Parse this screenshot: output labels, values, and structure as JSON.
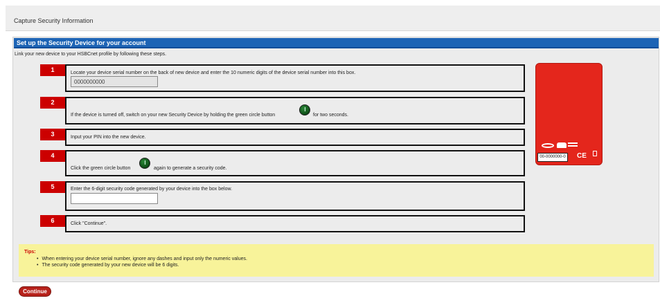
{
  "window": {
    "title": "Capture Security Information"
  },
  "section": {
    "header": "Set up the Security Device for your account",
    "intro": "Link your new device to your HSBCnet profile by following these steps."
  },
  "steps": [
    {
      "number": "1",
      "text": "Locate your device serial number on the back of new device and enter the 10 numeric digits of the device serial number into this box.",
      "input_value": "0000000000"
    },
    {
      "number": "2",
      "text_before": "If the device is turned off, switch on your new Security Device by holding the green circle button",
      "text_after": "for two seconds."
    },
    {
      "number": "3",
      "text": "Input your PIN into the new device."
    },
    {
      "number": "4",
      "text_before": "Click the green circle button",
      "text_after": "again to generate a security code."
    },
    {
      "number": "5",
      "text": "Enter the 6-digit security code generated by your device into the box below.",
      "input_value": ""
    },
    {
      "number": "6",
      "text": "Click \"Continue\"."
    }
  ],
  "device": {
    "serial_label": "00-0000000-0",
    "ce_mark": "CE",
    "icons": [
      "vasco-logo",
      "hsbc-logo",
      "recycle-bin-icon"
    ]
  },
  "tips": {
    "title": "Tips:",
    "items": [
      "When entering your device serial number, ignore any dashes and input only the numeric values.",
      "The security code generated by your new device will be 6 digits."
    ]
  },
  "actions": {
    "continue_label": "Continue"
  },
  "colors": {
    "header_blue": "#1d64b5",
    "step_red": "#cc0000",
    "device_red": "#e4261c",
    "tips_yellow": "#f8f39a",
    "button_red": "#b7221b"
  }
}
